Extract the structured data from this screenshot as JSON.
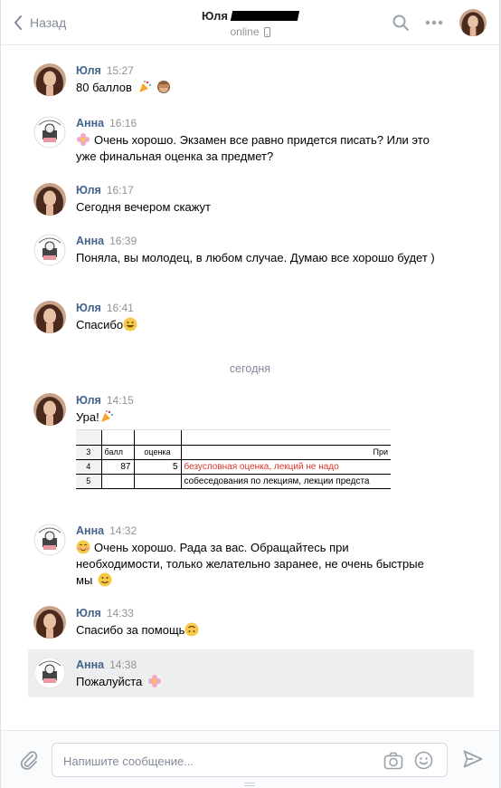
{
  "header": {
    "back_label": "Назад",
    "title": "Юля",
    "status": "online"
  },
  "messages": [
    {
      "author": "Юля",
      "time": "15:27",
      "text": "80 баллов"
    },
    {
      "author": "Анна",
      "time": "16:16",
      "text": "Очень хорошо. Экзамен все равно придется писать? Или это уже финальная оценка за предмет?"
    },
    {
      "author": "Юля",
      "time": "16:17",
      "text": "Сегодня вечером скажут"
    },
    {
      "author": "Анна",
      "time": "16:39",
      "text": "Поняла, вы молодец, в любом случае. Думаю все хорошо будет )"
    },
    {
      "author": "Юля",
      "time": "16:41",
      "text": "Спасибо"
    },
    {
      "author": "Юля",
      "time": "14:15",
      "text": "Ура!"
    },
    {
      "author": "Анна",
      "time": "14:32",
      "text": "Очень хорошо. Рада за вас. Обращайтесь при необходимости, только желательно заранее, не очень быстрые мы"
    },
    {
      "author": "Юля",
      "time": "14:33",
      "text": "Спасибо за помощь"
    },
    {
      "author": "Анна",
      "time": "14:38",
      "text": "Пожалуйста"
    }
  ],
  "divider": "сегодня",
  "attachment": {
    "rows": [
      {
        "num": "",
        "c1": "",
        "c2": "",
        "c3": ""
      },
      {
        "num": "3",
        "c1": "балл",
        "c2": "оценка",
        "c3": "При"
      },
      {
        "num": "4",
        "c1": "87",
        "c2": "5",
        "c3": "безусловная оценка, лекций не надо"
      },
      {
        "num": "5",
        "c1": "",
        "c2": "",
        "c3": "собеседования по лекциям, лекции предста"
      }
    ],
    "highlight_color": "#d9362b"
  },
  "composer": {
    "placeholder": "Напишите сообщение..."
  },
  "colors": {
    "author": "#42648b",
    "time": "#939393",
    "highlight_bg": "#edeef0"
  }
}
